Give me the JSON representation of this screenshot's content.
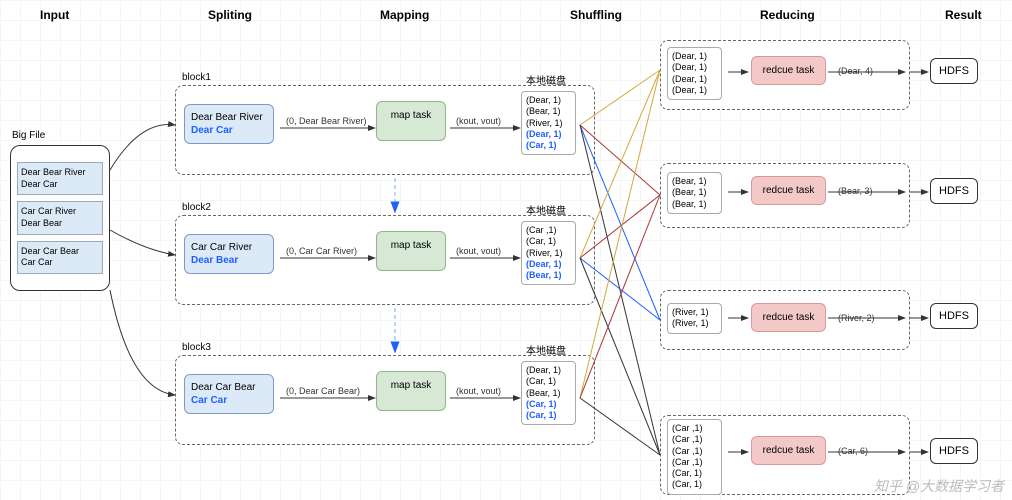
{
  "headers": {
    "input": "Input",
    "splitting": "Spliting",
    "mapping": "Mapping",
    "shuffling": "Shuffling",
    "reducing": "Reducing",
    "result": "Result"
  },
  "bigfile": {
    "title": "Big File",
    "items": [
      "Dear Bear River\nDear Car",
      "Car Car River\nDear Bear",
      "Dear Car Bear\nCar Car"
    ]
  },
  "blocks": [
    {
      "label": "block1",
      "split": [
        "Dear Bear River",
        "Dear Car"
      ],
      "mapIn": "(0, Dear Bear River)",
      "mapLabel": "map task",
      "mapOut": "(kout, vout)",
      "disk": "本地磁盘",
      "kv": [
        "(Dear, 1)",
        "(Bear, 1)",
        "(River, 1)",
        "(Dear, 1)",
        "(Car, 1)"
      ],
      "blueIdx": [
        3,
        4
      ]
    },
    {
      "label": "block2",
      "split": [
        "Car Car River",
        "Dear Bear"
      ],
      "mapIn": "(0, Car Car River)",
      "mapLabel": "map task",
      "mapOut": "(kout, vout)",
      "disk": "本地磁盘",
      "kv": [
        "(Car ,1)",
        "(Car, 1)",
        "(River, 1)",
        "(Dear, 1)",
        "(Bear, 1)"
      ],
      "blueIdx": [
        3,
        4
      ]
    },
    {
      "label": "block3",
      "split": [
        "Dear Car Bear",
        "Car Car"
      ],
      "mapIn": "(0, Dear Car Bear)",
      "mapLabel": "map task",
      "mapOut": "(kout, vout)",
      "disk": "本地磁盘",
      "kv": [
        "(Dear, 1)",
        "(Car, 1)",
        "(Bear, 1)",
        "(Car, 1)",
        "(Car, 1)"
      ],
      "blueIdx": [
        3,
        4
      ]
    }
  ],
  "reducers": [
    {
      "in": [
        "(Dear, 1)",
        "(Dear, 1)",
        "(Dear, 1)",
        "(Dear, 1)"
      ],
      "task": "redcue task",
      "out": "(Dear, 4)",
      "result": "HDFS"
    },
    {
      "in": [
        "(Bear, 1)",
        "(Bear, 1)",
        "(Bear, 1)"
      ],
      "task": "redcue task",
      "out": "(Bear, 3)",
      "result": "HDFS"
    },
    {
      "in": [
        "(River, 1)",
        "(River, 1)"
      ],
      "task": "redcue task",
      "out": "(River, 2)",
      "result": "HDFS"
    },
    {
      "in": [
        "(Car ,1)",
        "(Car ,1)",
        "(Car ,1)",
        "(Car ,1)",
        "(Car, 1)",
        "(Car, 1)"
      ],
      "task": "redcue task",
      "out": "(Car, 6)",
      "result": "HDFS"
    }
  ],
  "watermark": "知乎 @大数据学习者"
}
